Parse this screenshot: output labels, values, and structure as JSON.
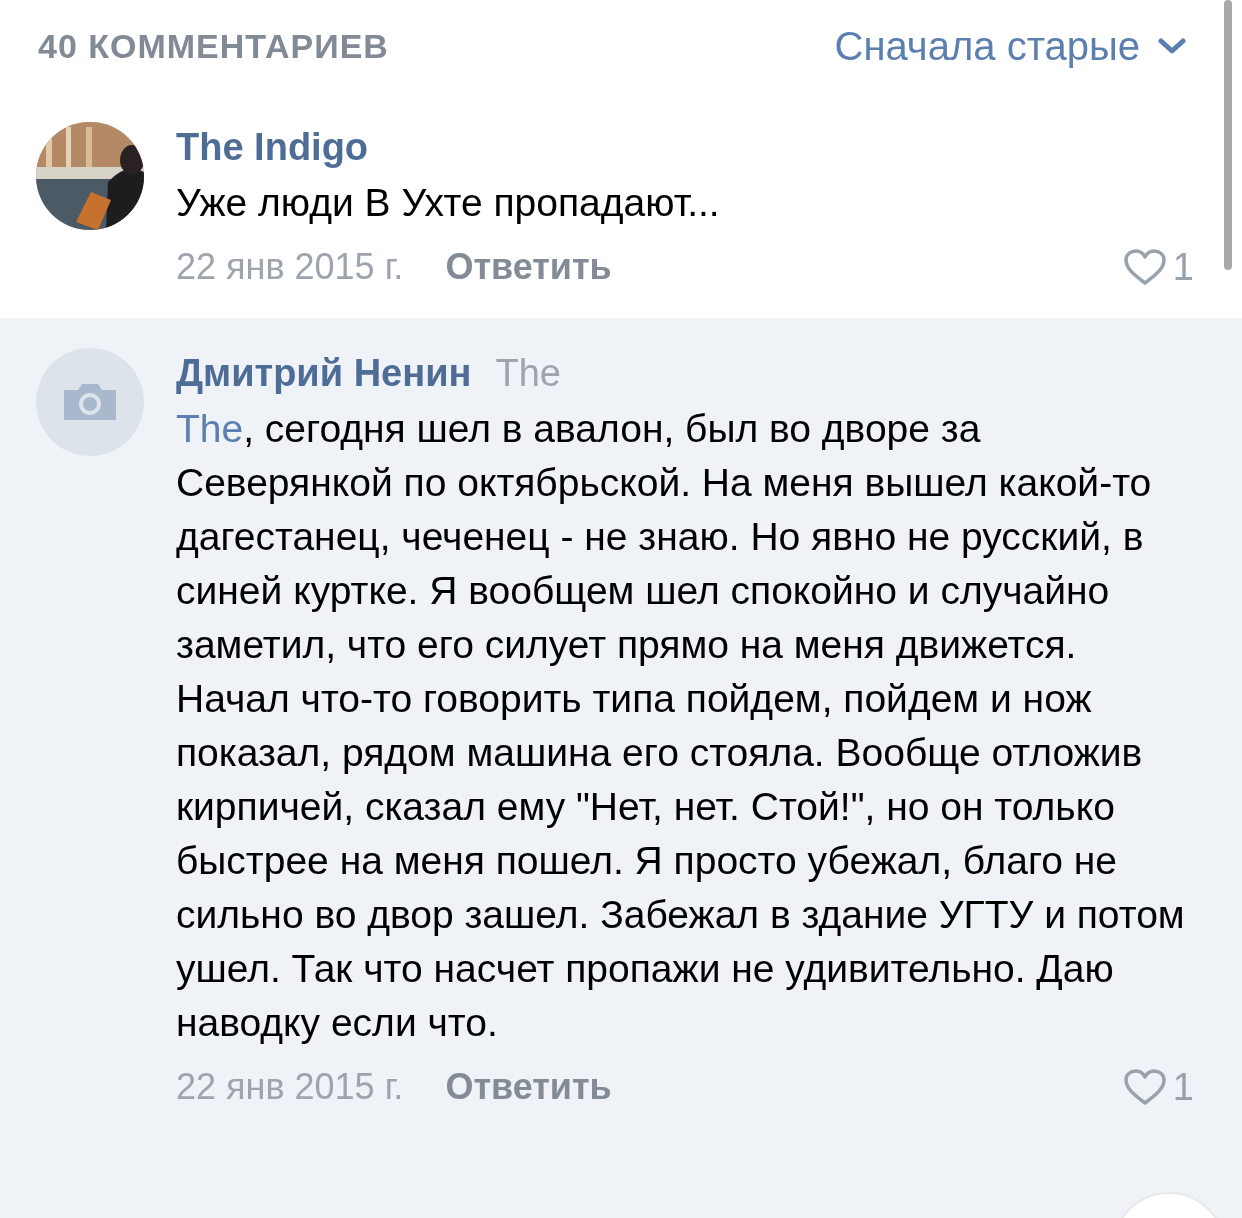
{
  "header": {
    "count": "40 КОММЕНТАРИЕВ",
    "sort": "Сначала старые"
  },
  "comments": [
    {
      "author": "The Indigo",
      "highlighted": false,
      "text": "Уже люди В Ухте пропадают...",
      "date": "22 янв 2015 г.",
      "reply": "Ответить",
      "likes": "1"
    },
    {
      "author": "Дмитрий Ненин",
      "reply_to": "The",
      "avatar": {
        "kind": "placeholder"
      },
      "highlighted": true,
      "mention": "The",
      "text": ", сегодня шел в авалон, был во дворе за Северянкой по октябрьской. На меня вышел какой-то дагестанец, чеченец - не знаю. Но явно не русский, в синей куртке. Я вообщем шел спокойно и случайно заметил, что его силует прямо на меня движется. Начал что-то говорить типа пойдем, пойдем и нож показал, рядом машина его стояла. Вообще отложив кирпичей, сказал ему \"Нет, нет. Стой!\", но он только быстрее на меня пошел. Я просто убежал, благо не сильно во двор зашел. Забежал в здание УГТУ и потом ушел. Так что насчет пропажи не удивительно. Даю наводку если что.",
      "date": "22 янв 2015 г.",
      "reply": "Ответить",
      "likes": "1"
    }
  ]
}
